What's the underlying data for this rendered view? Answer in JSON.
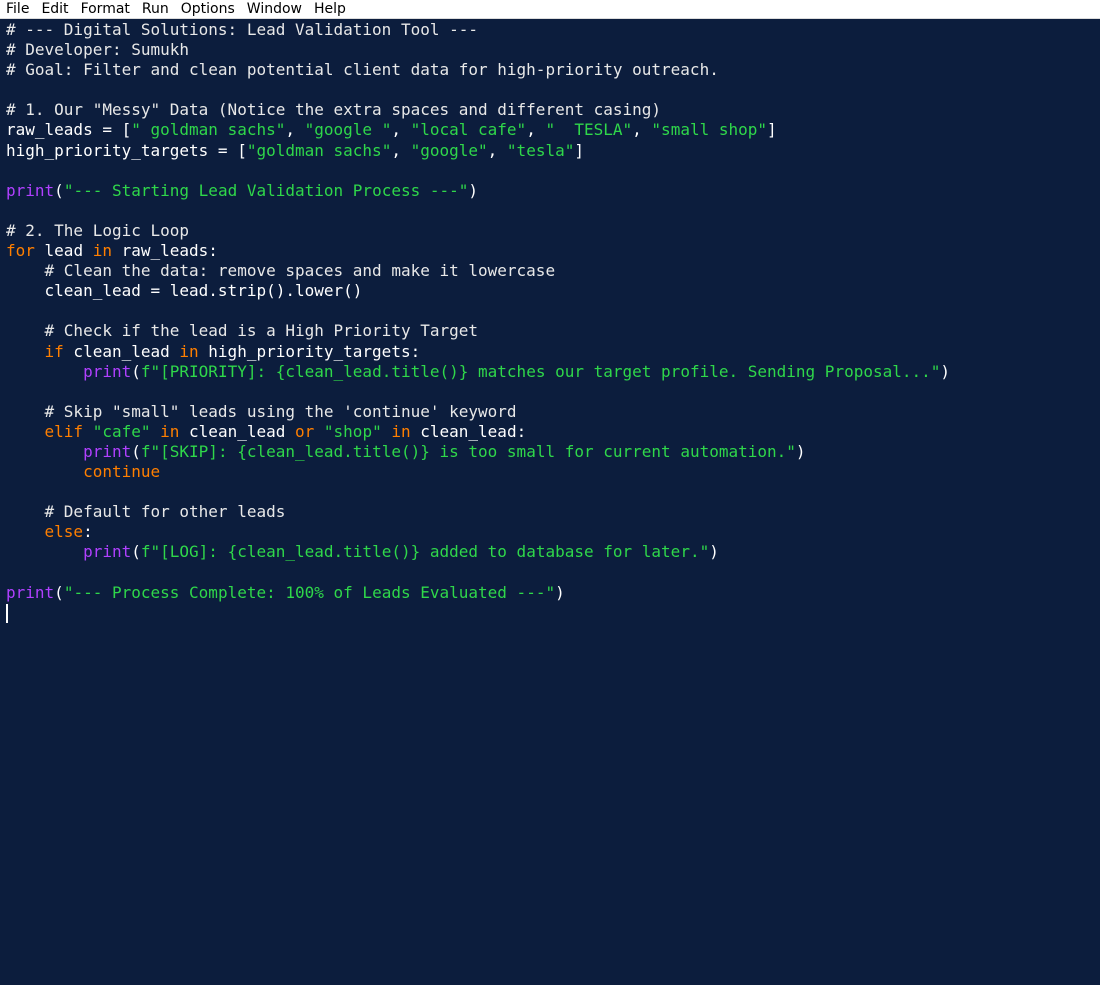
{
  "menu": {
    "items": [
      "File",
      "Edit",
      "Format",
      "Run",
      "Options",
      "Window",
      "Help"
    ]
  },
  "colors": {
    "background": "#0c1d3d",
    "comment": "#e8e8e8",
    "keyword": "#ff7f00",
    "string": "#2fd74a",
    "builtin": "#b040ff",
    "text": "#ffffff"
  },
  "code": {
    "lines": [
      [
        [
          "cm",
          "# --- Digital Solutions: Lead Validation Tool ---"
        ]
      ],
      [
        [
          "cm",
          "# Developer: Sumukh"
        ]
      ],
      [
        [
          "cm",
          "# Goal: Filter and clean potential client data for high-priority outreach."
        ]
      ],
      [],
      [
        [
          "cm",
          "# 1. Our \"Messy\" Data (Notice the extra spaces and different casing)"
        ]
      ],
      [
        [
          "tx",
          "raw_leads = ["
        ],
        [
          "st",
          "\" goldman sachs\""
        ],
        [
          "tx",
          ", "
        ],
        [
          "st",
          "\"google \""
        ],
        [
          "tx",
          ", "
        ],
        [
          "st",
          "\"local cafe\""
        ],
        [
          "tx",
          ", "
        ],
        [
          "st",
          "\"  TESLA\""
        ],
        [
          "tx",
          ", "
        ],
        [
          "st",
          "\"small shop\""
        ],
        [
          "tx",
          "]"
        ]
      ],
      [
        [
          "tx",
          "high_priority_targets = ["
        ],
        [
          "st",
          "\"goldman sachs\""
        ],
        [
          "tx",
          ", "
        ],
        [
          "st",
          "\"google\""
        ],
        [
          "tx",
          ", "
        ],
        [
          "st",
          "\"tesla\""
        ],
        [
          "tx",
          "]"
        ]
      ],
      [],
      [
        [
          "bi",
          "print"
        ],
        [
          "tx",
          "("
        ],
        [
          "st",
          "\"--- Starting Lead Validation Process ---\""
        ],
        [
          "tx",
          ")"
        ]
      ],
      [],
      [
        [
          "cm",
          "# 2. The Logic Loop"
        ]
      ],
      [
        [
          "kw",
          "for"
        ],
        [
          "tx",
          " lead "
        ],
        [
          "kw",
          "in"
        ],
        [
          "tx",
          " raw_leads:"
        ]
      ],
      [
        [
          "tx",
          "    "
        ],
        [
          "cm",
          "# Clean the data: remove spaces and make it lowercase"
        ]
      ],
      [
        [
          "tx",
          "    clean_lead = lead.strip().lower()"
        ]
      ],
      [],
      [
        [
          "tx",
          "    "
        ],
        [
          "cm",
          "# Check if the lead is a High Priority Target"
        ]
      ],
      [
        [
          "tx",
          "    "
        ],
        [
          "kw",
          "if"
        ],
        [
          "tx",
          " clean_lead "
        ],
        [
          "kw",
          "in"
        ],
        [
          "tx",
          " high_priority_targets:"
        ]
      ],
      [
        [
          "tx",
          "        "
        ],
        [
          "bi",
          "print"
        ],
        [
          "tx",
          "("
        ],
        [
          "st",
          "f\"[PRIORITY]: {clean_lead.title()} matches our target profile. Sending Proposal...\""
        ],
        [
          "tx",
          ")"
        ]
      ],
      [],
      [
        [
          "tx",
          "    "
        ],
        [
          "cm",
          "# Skip \"small\" leads using the 'continue' keyword"
        ]
      ],
      [
        [
          "tx",
          "    "
        ],
        [
          "kw",
          "elif"
        ],
        [
          "tx",
          " "
        ],
        [
          "st",
          "\"cafe\""
        ],
        [
          "tx",
          " "
        ],
        [
          "kw",
          "in"
        ],
        [
          "tx",
          " clean_lead "
        ],
        [
          "kw",
          "or"
        ],
        [
          "tx",
          " "
        ],
        [
          "st",
          "\"shop\""
        ],
        [
          "tx",
          " "
        ],
        [
          "kw",
          "in"
        ],
        [
          "tx",
          " clean_lead:"
        ]
      ],
      [
        [
          "tx",
          "        "
        ],
        [
          "bi",
          "print"
        ],
        [
          "tx",
          "("
        ],
        [
          "st",
          "f\"[SKIP]: {clean_lead.title()} is too small for current automation.\""
        ],
        [
          "tx",
          ")"
        ]
      ],
      [
        [
          "tx",
          "        "
        ],
        [
          "kw",
          "continue"
        ]
      ],
      [],
      [
        [
          "tx",
          "    "
        ],
        [
          "cm",
          "# Default for other leads"
        ]
      ],
      [
        [
          "tx",
          "    "
        ],
        [
          "kw",
          "else"
        ],
        [
          "tx",
          ":"
        ]
      ],
      [
        [
          "tx",
          "        "
        ],
        [
          "bi",
          "print"
        ],
        [
          "tx",
          "("
        ],
        [
          "st",
          "f\"[LOG]: {clean_lead.title()} added to database for later.\""
        ],
        [
          "tx",
          ")"
        ]
      ],
      [],
      [
        [
          "bi",
          "print"
        ],
        [
          "tx",
          "("
        ],
        [
          "st",
          "\"--- Process Complete: 100% of Leads Evaluated ---\""
        ],
        [
          "tx",
          ")"
        ]
      ]
    ]
  }
}
